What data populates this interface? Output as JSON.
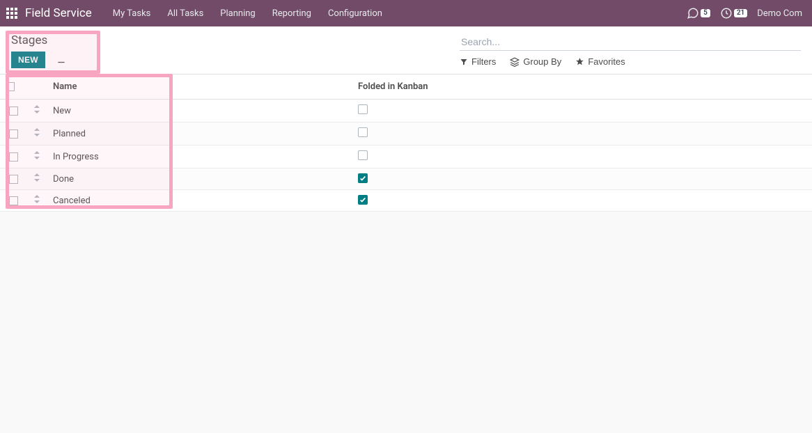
{
  "brand": "Field Service",
  "nav": [
    "My Tasks",
    "All Tasks",
    "Planning",
    "Reporting",
    "Configuration"
  ],
  "messages_badge": "5",
  "activities_badge": "21",
  "user_name": "Demo Com",
  "page_title": "Stages",
  "new_button": "NEW",
  "search_placeholder": "Search...",
  "filters_label": "Filters",
  "groupby_label": "Group By",
  "favorites_label": "Favorites",
  "columns": {
    "name": "Name",
    "folded": "Folded in Kanban"
  },
  "rows": [
    {
      "name": "New",
      "folded": false
    },
    {
      "name": "Planned",
      "folded": false
    },
    {
      "name": "In Progress",
      "folded": false
    },
    {
      "name": "Done",
      "folded": true
    },
    {
      "name": "Canceled",
      "folded": true
    }
  ]
}
